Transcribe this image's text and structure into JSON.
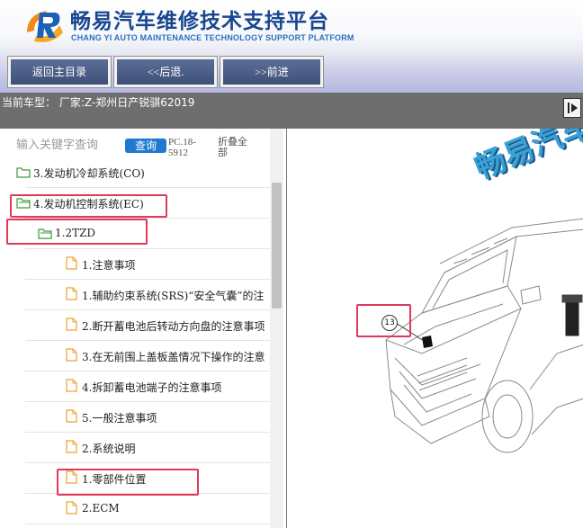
{
  "header": {
    "title_cn": "畅易汽车维修技术支持平台",
    "title_en": "CHANG YI AUTO MAINTENANCE TECHNOLOGY SUPPORT PLATFORM"
  },
  "toolbar": {
    "home_label": "返回主目录",
    "back_label": "<<后退.",
    "forward_label": ">>前进"
  },
  "status": {
    "current_vehicle": "当前车型：  厂家:Z-郑州日产锐骐62019"
  },
  "search": {
    "placeholder": "输入关键字查询",
    "button_label": "查询",
    "model_code": "PC.18-5912",
    "collapse_all": "折叠全部"
  },
  "tree": {
    "items": [
      {
        "label": "3.发动机冷却系统(CO)",
        "icon": "folder-open-icon"
      },
      {
        "label": "4.发动机控制系统(EC)",
        "icon": "folder-open-icon"
      },
      {
        "label": "1.2TZD",
        "icon": "folder-open-icon"
      },
      {
        "label": "1.注意事项",
        "icon": "document-icon"
      },
      {
        "label": "1.辅助约束系统(SRS)“安全气囊”的注",
        "icon": "document-icon"
      },
      {
        "label": "2.断开蓄电池后转动方向盘的注意事项",
        "icon": "document-icon"
      },
      {
        "label": "3.在无前围上盖板盖情况下操作的注意",
        "icon": "document-icon"
      },
      {
        "label": "4.拆卸蓄电池端子的注意事项",
        "icon": "document-icon"
      },
      {
        "label": "5.一般注意事项",
        "icon": "document-icon"
      },
      {
        "label": "2.系统说明",
        "icon": "document-icon"
      },
      {
        "label": "1.零部件位置",
        "icon": "document-icon"
      },
      {
        "label": "2.ECM",
        "icon": "document-icon"
      }
    ]
  },
  "figure": {
    "watermark": "畅易汽车",
    "callout_number": "13"
  },
  "colors": {
    "brand_blue": "#17468f",
    "highlight_red": "#e0385a",
    "folder_green": "#3c9a3c",
    "doc_orange": "#f0a030"
  }
}
